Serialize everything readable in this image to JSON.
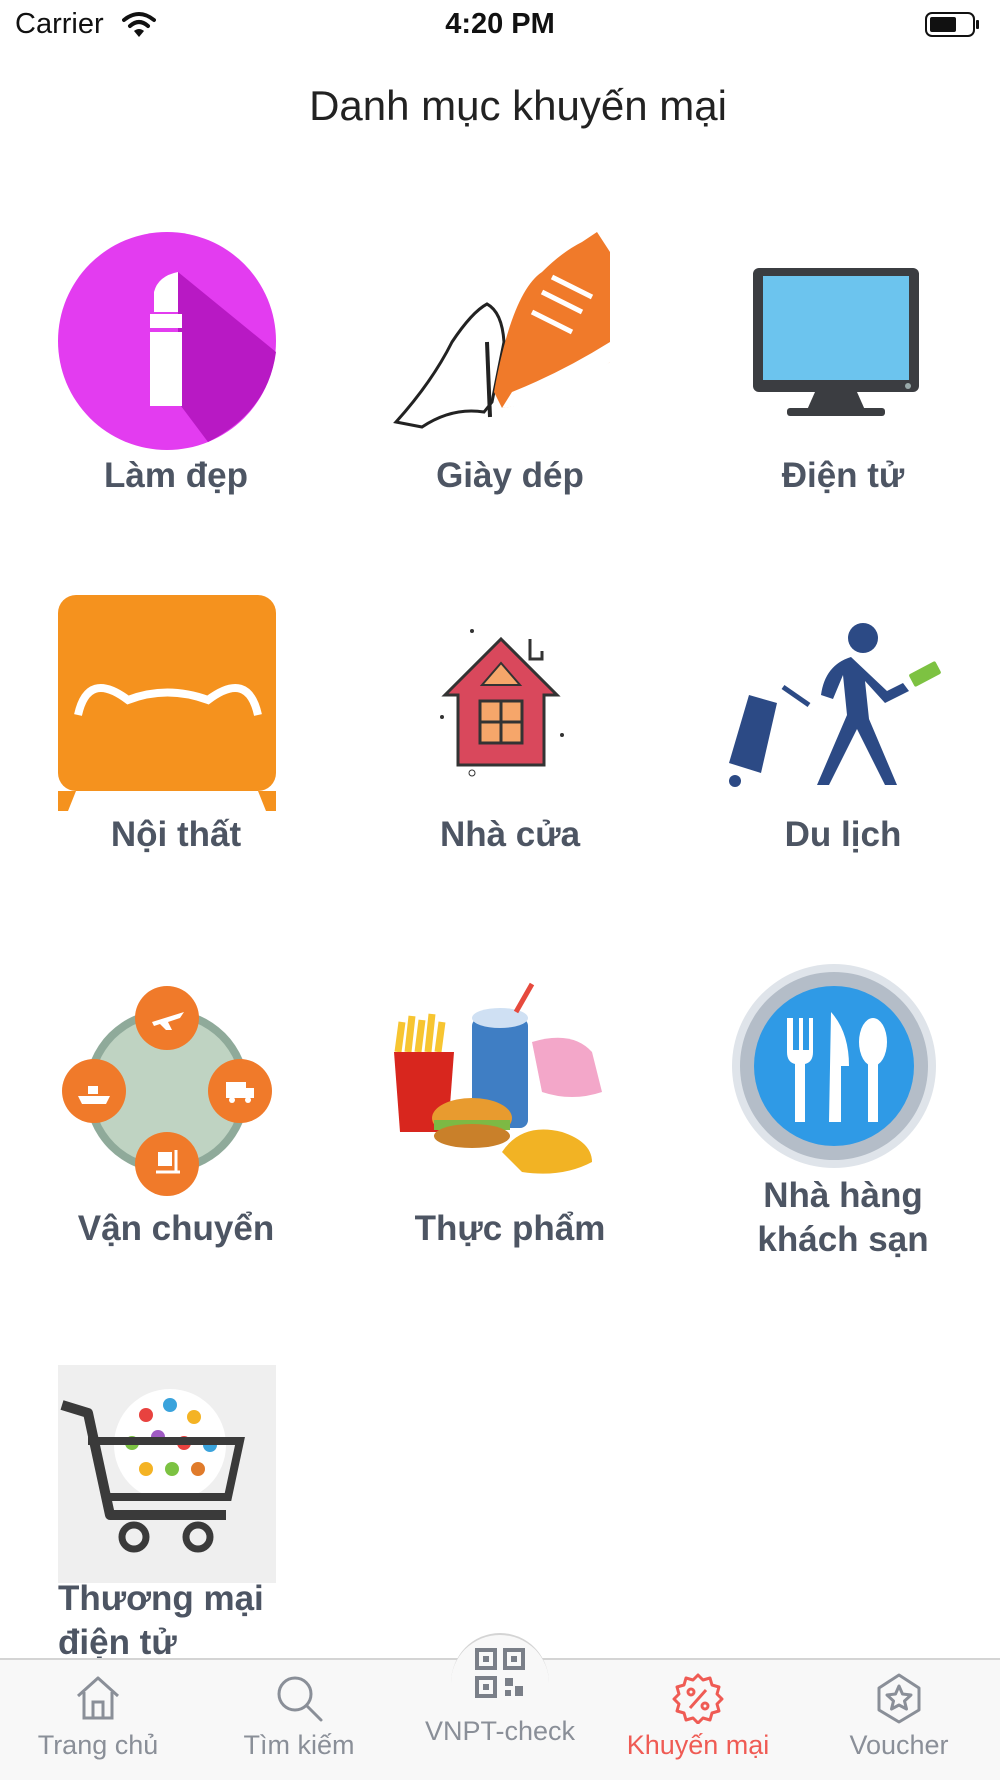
{
  "status": {
    "carrier": "Carrier",
    "time": "4:20 PM"
  },
  "title": "Danh mục khuyến mại",
  "categories": [
    {
      "label": "Làm đẹp",
      "icon": "lipstick-icon"
    },
    {
      "label": "Giày dép",
      "icon": "shoes-icon"
    },
    {
      "label": "Điện tử",
      "icon": "monitor-icon"
    },
    {
      "label": "Nội thất",
      "icon": "sofa-icon"
    },
    {
      "label": "Nhà cửa",
      "icon": "house-icon"
    },
    {
      "label": "Du lịch",
      "icon": "traveler-icon"
    },
    {
      "label": "Vận chuyển",
      "icon": "shipping-icon"
    },
    {
      "label": "Thực phẩm",
      "icon": "fast-food-icon"
    },
    {
      "label": "Nhà hàng khách sạn",
      "icon": "cutlery-plate-icon"
    },
    {
      "label": "Thương mại điện tử",
      "icon": "shopping-cart-icon"
    }
  ],
  "tabs": [
    {
      "label": "Trang chủ",
      "icon": "home-icon",
      "active": false
    },
    {
      "label": "Tìm kiếm",
      "icon": "search-icon",
      "active": false
    },
    {
      "label": "VNPT-check",
      "icon": "qr-code-icon",
      "active": false
    },
    {
      "label": "Khuyến mại",
      "icon": "discount-badge-icon",
      "active": true
    },
    {
      "label": "Voucher",
      "icon": "star-badge-icon",
      "active": false
    }
  ],
  "colors": {
    "accent": "#ef5b54",
    "tab_inactive": "#8a8f98",
    "label": "#4d5563"
  }
}
